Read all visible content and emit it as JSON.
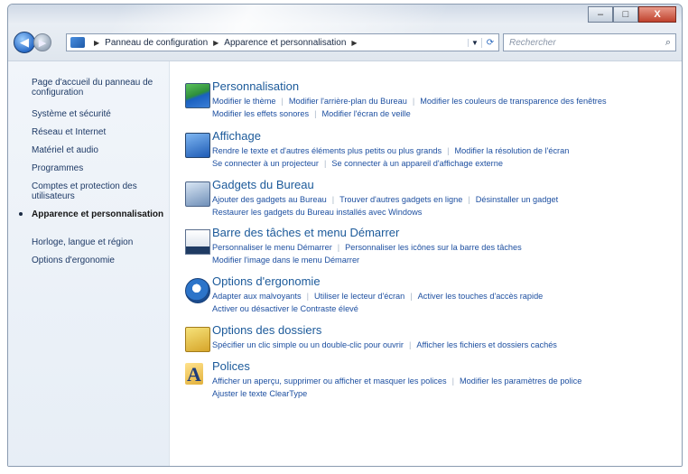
{
  "window": {
    "caption": {
      "minimize": "–",
      "maximize": "□",
      "close": "X"
    }
  },
  "address_bar": {
    "crumbs": [
      "Panneau de configuration",
      "Apparence et personnalisation"
    ],
    "search_placeholder": "Rechercher"
  },
  "sidebar": {
    "items": [
      {
        "label": "Page d'accueil du panneau de configuration"
      },
      {
        "label": "Système et sécurité"
      },
      {
        "label": "Réseau et Internet"
      },
      {
        "label": "Matériel et audio"
      },
      {
        "label": "Programmes"
      },
      {
        "label": "Comptes et protection des utilisateurs"
      },
      {
        "label": "Apparence et personnalisation"
      },
      {
        "label": "Horloge, langue et région"
      },
      {
        "label": "Options d'ergonomie"
      }
    ]
  },
  "categories": [
    {
      "title": "Personnalisation",
      "icon": "personalization-icon",
      "lines": [
        [
          "Modifier le thème",
          "Modifier l'arrière-plan du Bureau",
          "Modifier les couleurs de transparence des fenêtres"
        ],
        [
          "Modifier les effets sonores",
          "Modifier l'écran de veille"
        ]
      ]
    },
    {
      "title": "Affichage",
      "icon": "display-icon",
      "lines": [
        [
          "Rendre le texte et d'autres éléments plus petits ou plus grands",
          "Modifier la résolution de l'écran"
        ],
        [
          "Se connecter à un projecteur",
          "Se connecter à un appareil d'affichage externe"
        ]
      ]
    },
    {
      "title": "Gadgets du Bureau",
      "icon": "gadgets-icon",
      "lines": [
        [
          "Ajouter des gadgets au Bureau",
          "Trouver d'autres gadgets en ligne",
          "Désinstaller un gadget"
        ],
        [
          "Restaurer les gadgets du Bureau installés avec Windows"
        ]
      ]
    },
    {
      "title": "Barre des tâches et menu Démarrer",
      "icon": "taskbar-icon",
      "lines": [
        [
          "Personnaliser le menu Démarrer",
          "Personnaliser les icônes sur la barre des tâches"
        ],
        [
          "Modifier l'image dans le menu Démarrer"
        ]
      ]
    },
    {
      "title": "Options d'ergonomie",
      "icon": "ease-of-access-icon",
      "lines": [
        [
          "Adapter aux malvoyants",
          "Utiliser le lecteur d'écran",
          "Activer les touches d'accès rapide"
        ],
        [
          "Activer ou désactiver le Contraste élevé"
        ]
      ]
    },
    {
      "title": "Options des dossiers",
      "icon": "folder-options-icon",
      "lines": [
        [
          "Spécifier un clic simple ou un double-clic pour ouvrir",
          "Afficher les fichiers et dossiers cachés"
        ]
      ]
    },
    {
      "title": "Polices",
      "icon": "fonts-icon",
      "lines": [
        [
          "Afficher un aperçu, supprimer ou afficher et masquer les polices",
          "Modifier les paramètres de police"
        ],
        [
          "Ajuster le texte ClearType"
        ]
      ]
    }
  ]
}
